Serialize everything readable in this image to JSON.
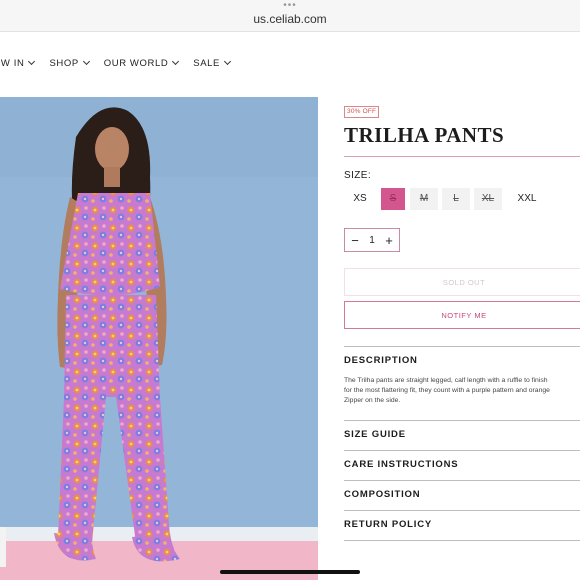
{
  "browser": {
    "dots": "•••",
    "url": "us.celiab.com"
  },
  "nav": {
    "items": [
      {
        "label": "EW IN"
      },
      {
        "label": "SHOP"
      },
      {
        "label": "OUR WORLD"
      },
      {
        "label": "SALE"
      }
    ]
  },
  "product": {
    "discount_badge": "30% OFF",
    "title": "TRILHA PANTS",
    "size_label": "SIZE:",
    "sizes": [
      {
        "label": "XS",
        "state": "available"
      },
      {
        "label": "S",
        "state": "selected-unavailable"
      },
      {
        "label": "M",
        "state": "unavailable"
      },
      {
        "label": "L",
        "state": "unavailable"
      },
      {
        "label": "XL",
        "state": "unavailable"
      },
      {
        "label": "XXL",
        "state": "available"
      }
    ],
    "quantity": {
      "minus": "−",
      "value": "1",
      "plus": "+"
    },
    "sold_out_label": "SOLD OUT",
    "notify_label": "NOTIFY ME",
    "accent_color": "#d4568f"
  },
  "sections": {
    "description": {
      "title": "DESCRIPTION",
      "text": "The Trilha pants are straight legged, calf length with a ruffle to finish\nfor the most flattering fit, they count with a purple pattern and  orange\nZipper on the side."
    },
    "size_guide": {
      "title": "SIZE GUIDE"
    },
    "care": {
      "title": "CARE INSTRUCTIONS"
    },
    "composition": {
      "title": "COMPOSITION"
    },
    "returns": {
      "title": "RETURN POLICY"
    }
  }
}
